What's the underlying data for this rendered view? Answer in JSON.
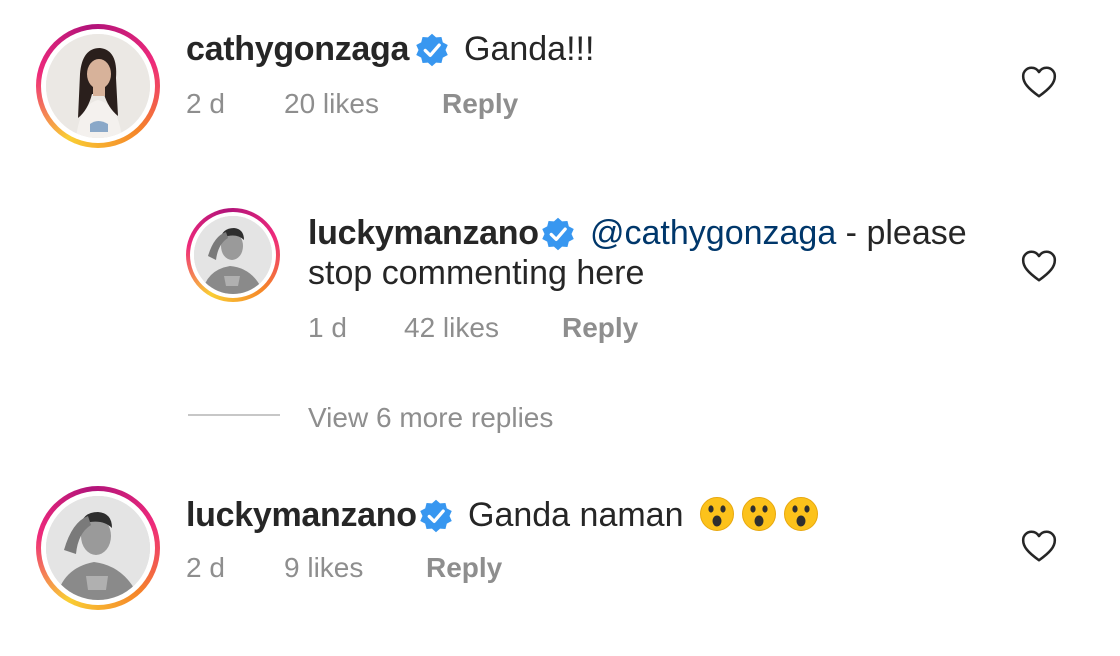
{
  "comments": [
    {
      "username": "cathygonzaga",
      "verified": true,
      "text": "Ganda!!!",
      "time": "2 d",
      "likes": "20 likes",
      "reply_label": "Reply"
    },
    {
      "username": "luckymanzano",
      "verified": true,
      "mention": "@cathygonzaga",
      "text_line1": " - please",
      "text_line2": "stop commenting here",
      "time": "1 d",
      "likes": "42 likes",
      "reply_label": "Reply"
    },
    {
      "username": "luckymanzano",
      "verified": true,
      "text": "Ganda naman",
      "emojis": [
        "astonished-face-emoji",
        "astonished-face-emoji",
        "astonished-face-emoji"
      ],
      "time": "2 d",
      "likes": "9 likes",
      "reply_label": "Reply"
    }
  ],
  "view_more_replies": "View 6 more replies",
  "colors": {
    "text": "#262626",
    "secondary": "#8e8e8e",
    "mention": "#00376b",
    "verified": "#3897f0"
  }
}
